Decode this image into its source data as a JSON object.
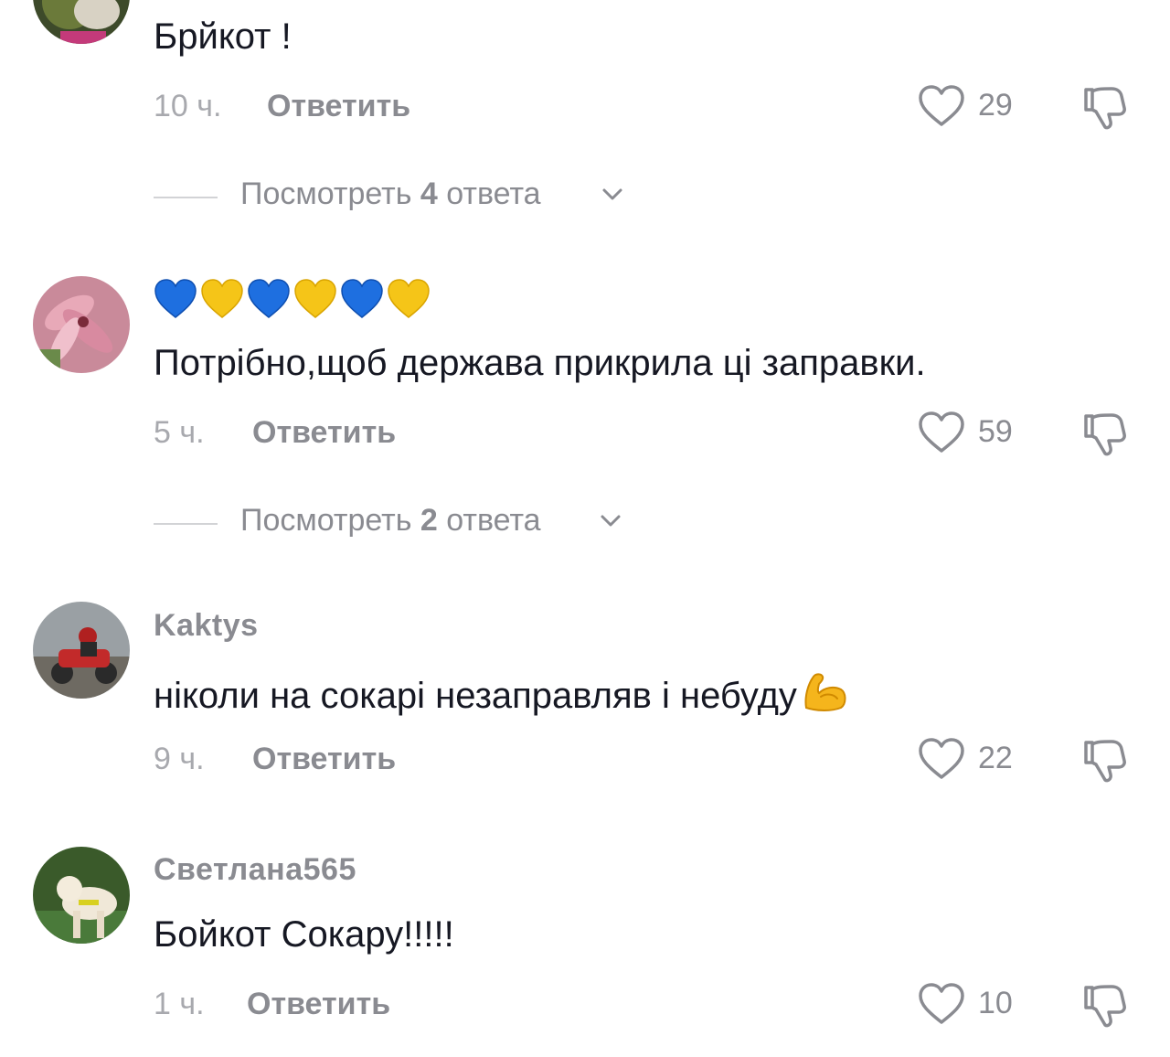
{
  "comments": [
    {
      "text": "Брйкот !",
      "time": "10 ч.",
      "reply_label": "Ответить",
      "likes": "29",
      "view_replies": {
        "prefix": "Посмотреть ",
        "count": "4",
        "suffix": " ответа"
      }
    },
    {
      "emoji_line": [
        "blue-heart",
        "yellow-heart",
        "blue-heart",
        "yellow-heart",
        "blue-heart",
        "yellow-heart"
      ],
      "text": "Потрібно,щоб держава прикрила ці заправки.",
      "time": "5 ч.",
      "reply_label": "Ответить",
      "likes": "59",
      "view_replies": {
        "prefix": "Посмотреть ",
        "count": "2",
        "suffix": " ответа"
      }
    },
    {
      "username": "Kaktys",
      "text": "ніколи на сокарі незаправляв і небуду",
      "text_emoji": "flexed-biceps",
      "time": "9 ч.",
      "reply_label": "Ответить",
      "likes": "22"
    },
    {
      "username": "Светлана565",
      "text": "Бойкот Сокару!!!!!",
      "time": "1 ч.",
      "reply_label": "Ответить",
      "likes": "10"
    }
  ],
  "colors": {
    "text_primary": "#161823",
    "text_secondary": "#8a8b91",
    "heart_blue": "#1e6fe0",
    "heart_yellow": "#f5c518"
  }
}
